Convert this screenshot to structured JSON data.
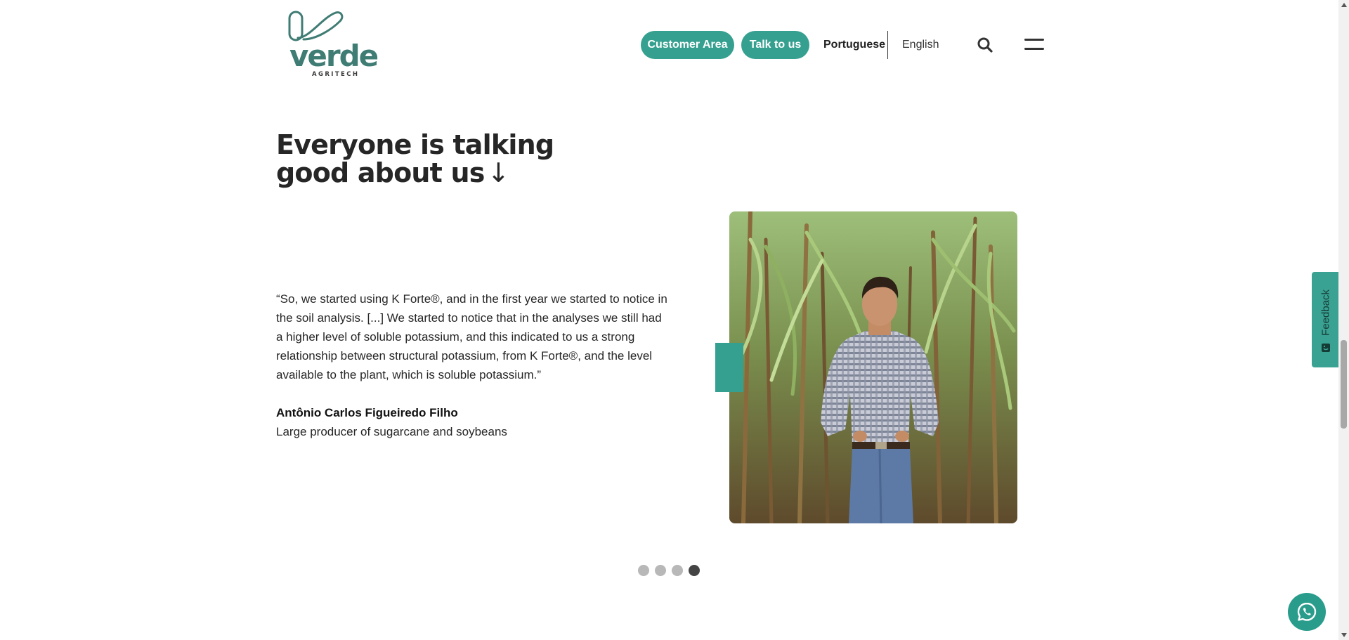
{
  "header": {
    "logo": {
      "name": "verde",
      "tagline": "AGRITECH",
      "icon": "verde-leaf-logo-icon"
    },
    "buttons": {
      "customer_area": "Customer Area",
      "talk_to_us": "Talk to us"
    },
    "languages": {
      "portuguese": "Portuguese",
      "english": "English",
      "active": "Portuguese"
    },
    "search_icon": "search-icon",
    "menu_icon": "hamburger-menu-icon"
  },
  "testimonials": {
    "heading_line1": "Everyone is talking",
    "heading_line2": "good about us",
    "heading_arrow": "↓",
    "quote": "“So, we started using K Forte®, and in the first year we started to notice in the soil analysis. [...] We started to notice that in the analyses we still had a higher level of soluble potassium, and this indicated to us a strong relationship between structural potassium, from K Forte®, and the level available to the plant, which is soluble potassium.”",
    "author": "Antônio Carlos Figueiredo Filho",
    "role": "Large producer of sugarcane and soybeans",
    "photo": "farmer-in-sugarcane-field-photo",
    "carousel": {
      "total_slides": 4,
      "active_slide": 4
    }
  },
  "widgets": {
    "feedback_label": "Feedback",
    "whatsapp_icon": "whatsapp-icon"
  },
  "colors": {
    "accent": "#35a090",
    "logo_green": "#3f7c74",
    "text": "#262626",
    "dot_inactive": "#b8b8b8",
    "dot_active": "#444444"
  }
}
